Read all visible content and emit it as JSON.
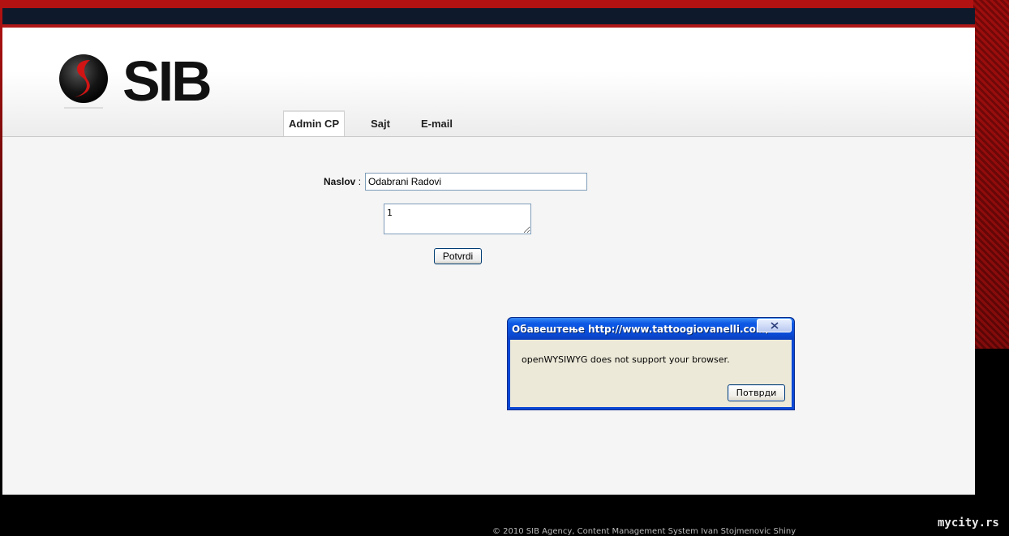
{
  "header": {
    "logo_text": "SIB",
    "nav": [
      {
        "label": "Admin CP",
        "active": true
      },
      {
        "label": "Sajt",
        "active": false
      },
      {
        "label": "E-mail",
        "active": false
      }
    ]
  },
  "form": {
    "title_label": "Naslov",
    "title_colon": " :",
    "title_value": "Odabrani Radovi",
    "body_value": "1",
    "submit_label": "Potvrdi"
  },
  "dialog": {
    "title": "Обавештење http://www.tattoogiovanelli.com/",
    "message": "openWYSIWYG does not support your browser.",
    "ok_label": "Потврди",
    "close_icon": "close-x"
  },
  "footer": {
    "text": "© 2010 SIB Agency, Content Management System Ivan Stojmenovic Shiny"
  },
  "watermark": "mycity.rs",
  "colors": {
    "brand_red": "#b01818",
    "topbar": "#0e1a2c",
    "dialog_blue": "#0a47d4"
  }
}
